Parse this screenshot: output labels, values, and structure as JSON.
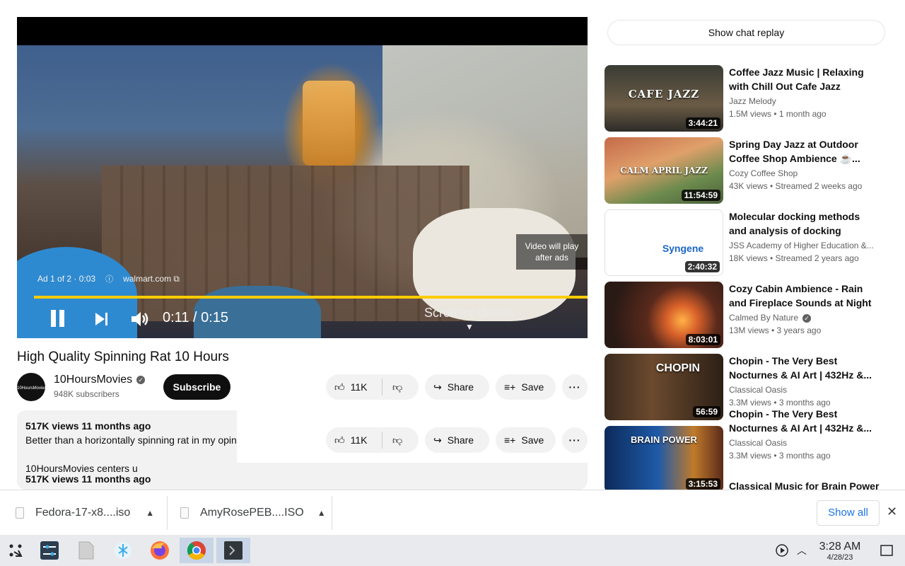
{
  "player": {
    "ad_label": "Ad 1 of 2 · 0:03",
    "ad_link": "walmart.com",
    "skip_text": "Video will play after ads",
    "time": "0:11 / 0:15",
    "scroll_hint": "Scroll for details",
    "progress": 1.0
  },
  "video": {
    "title": "High Quality Spinning Rat 10 Hours",
    "channel": "10HoursMovies",
    "avatar_text": "10HoursMovies",
    "subscribers": "948K subscribers",
    "subscribe_label": "Subscribe",
    "likes": "11K",
    "share_label": "Share",
    "save_label": "Save"
  },
  "description": {
    "views": "517K views  11 months ago",
    "text": "Better than a horizontally spinning rat in my opinion",
    "text2": "10HoursMovies centers u",
    "views2": "517K views  11 months ago"
  },
  "sidebar": {
    "chat_replay": "Show chat replay",
    "recommendations": [
      {
        "title": "Coffee Jazz Music | Relaxing with Chill Out Cafe Jazz Music...",
        "channel": "Jazz Melody",
        "meta": "1.5M views  • 1 month ago",
        "duration": "3:44:21",
        "thumb_text": "CAFE JAZZ",
        "verified": false
      },
      {
        "title": "Spring Day Jazz at Outdoor Coffee Shop Ambience ☕...",
        "channel": "Cozy Coffee Shop",
        "meta": "43K views  • Streamed 2 weeks ago",
        "duration": "11:54:59",
        "thumb_text": "CALM APRIL JAZZ",
        "verified": false
      },
      {
        "title": "Molecular docking methods and analysis of docking",
        "channel": "JSS Academy of Higher Education &...",
        "meta": "18K views  • Streamed 2 years ago",
        "duration": "2:40:32",
        "thumb_text": "Syngene",
        "verified": false
      },
      {
        "title": "Cozy Cabin Ambience - Rain and Fireplace Sounds at Night ...",
        "channel": "Calmed By Nature",
        "meta": "13M views  • 3 years ago",
        "duration": "8:03:01",
        "thumb_text": "",
        "verified": true
      },
      {
        "title": "Chopin - The Very Best Nocturnes & AI Art | 432Hz &...",
        "channel": "Classical Oasis",
        "meta": "3.3M views  • 3 months ago",
        "duration": "56:59",
        "thumb_text": "CHOPIN",
        "verified": false
      },
      {
        "title": "Chopin - The Very Best Nocturnes & AI Art | 432Hz &...",
        "channel": "Classical Oasis",
        "meta": "3.3M views  • 3 months ago",
        "duration": "3:15:53",
        "thumb_text": "BRAIN POWER",
        "verified": false
      },
      {
        "title": "Classical Music for Brain Power",
        "channel": "",
        "meta": "",
        "duration": "",
        "thumb_text": "",
        "verified": false
      }
    ]
  },
  "downloads": {
    "items": [
      "Fedora-17-x8....iso",
      "AmyRosePEB....ISO"
    ],
    "show_all": "Show all"
  },
  "taskbar": {
    "time": "3:28 AM",
    "date": "4/28/23"
  }
}
